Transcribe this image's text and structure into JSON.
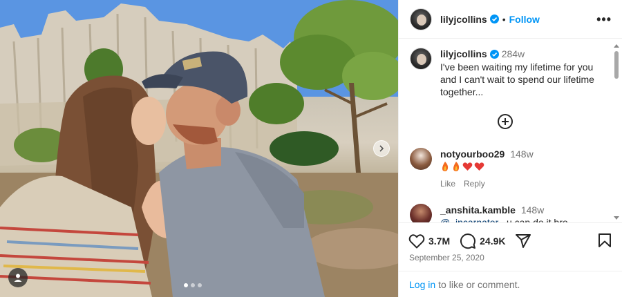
{
  "post": {
    "author": "lilyjcollins",
    "follow_label": "Follow",
    "separator": "•",
    "more_label": "•••"
  },
  "caption": {
    "author": "lilyjcollins",
    "time": "284w",
    "text": "I've been waiting my lifetime for you and I can't wait to spend our lifetime together..."
  },
  "comments": [
    {
      "author": "notyourboo29",
      "time": "148w",
      "text": "",
      "emojis": [
        "fire-emoji",
        "fire-emoji",
        "red-heart-emoji",
        "red-heart-emoji"
      ],
      "like_label": "Like",
      "reply_label": "Reply"
    },
    {
      "author": "_anshita.kamble",
      "time": "148w",
      "mention": "@_incarnator_",
      "text": "u can do it bro"
    }
  ],
  "actions": {
    "likes": "3.7M",
    "comments": "24.9K"
  },
  "date": "September 25, 2020",
  "footer": {
    "login_label": "Log in",
    "rest_label": "to like or comment."
  },
  "colors": {
    "accent": "#0095f6",
    "text": "#262626",
    "muted": "#737373",
    "verified": "#0095f6"
  }
}
